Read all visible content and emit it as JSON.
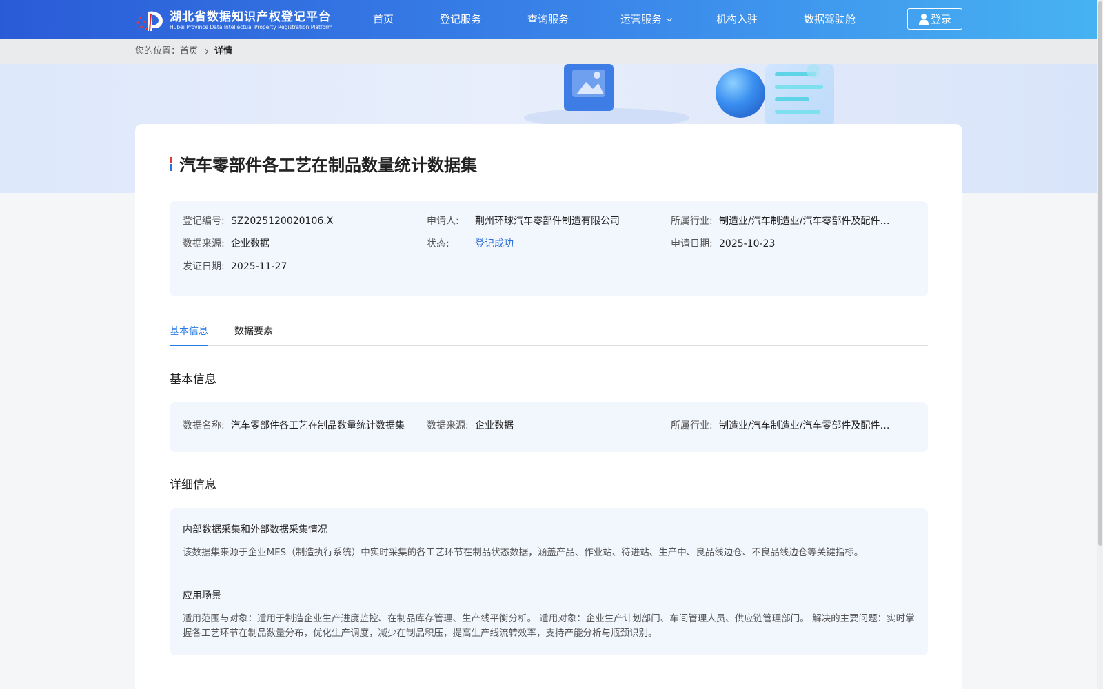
{
  "header": {
    "logo_cn": "湖北省数据知识产权登记平台",
    "logo_en": "Hubei Province Data Intellectual Property Registration Platform",
    "nav": [
      "首页",
      "登记服务",
      "查询服务",
      "运营服务",
      "机构入驻",
      "数据驾驶舱"
    ],
    "login_label": "登录"
  },
  "breadcrumb": {
    "prefix": "您的位置：",
    "home": "首页",
    "current": "详情"
  },
  "detail": {
    "title": "汽车零部件各工艺在制品数量统计数据集",
    "summary": {
      "reg_no_label": "登记编号:",
      "reg_no": "SZ2025120020106.X",
      "applicant_label": "申请人:",
      "applicant": "荆州环球汽车零部件制造有限公司",
      "industry_label": "所属行业:",
      "industry": "制造业/汽车制造业/汽车零部件及配件制...",
      "source_label": "数据来源:",
      "source": "企业数据",
      "status_label": "状态:",
      "status": "登记成功",
      "apply_date_label": "申请日期:",
      "apply_date": "2025-10-23",
      "cert_date_label": "发证日期:",
      "cert_date": "2025-11-27"
    },
    "tabs": [
      "基本信息",
      "数据要素"
    ],
    "basic": {
      "section_title": "基本信息",
      "name_label": "数据名称:",
      "name": "汽车零部件各工艺在制品数量统计数据集",
      "source_label": "数据来源:",
      "source": "企业数据",
      "industry_label": "所属行业:",
      "industry": "制造业/汽车制造业/汽车零部件及配件制..."
    },
    "more": {
      "section_title": "详细信息",
      "collect_title": "内部数据采集和外部数据采集情况",
      "collect_text": "该数据集来源于企业MES（制造执行系统）中实时采集的各工艺环节在制品状态数据，涵盖产品、作业站、待进站、生产中、良品线边仓、不良品线边仓等关键指标。",
      "scene_title": "应用场景",
      "scene_text": "适用范围与对象：适用于制造企业生产进度监控、在制品库存管理、生产线平衡分析。 适用对象：企业生产计划部门、车间管理人员、供应链管理部门。 解决的主要问题：实时掌握各工艺环节在制品数量分布，优化生产调度，减少在制品积压，提高生产线流转效率，支持产能分析与瓶颈识别。"
    }
  },
  "colors": {
    "nav_start": "#2a5bd7",
    "nav_end": "#47b3f2",
    "accent": "#2a7ae2",
    "status": "#2a6fdb"
  }
}
